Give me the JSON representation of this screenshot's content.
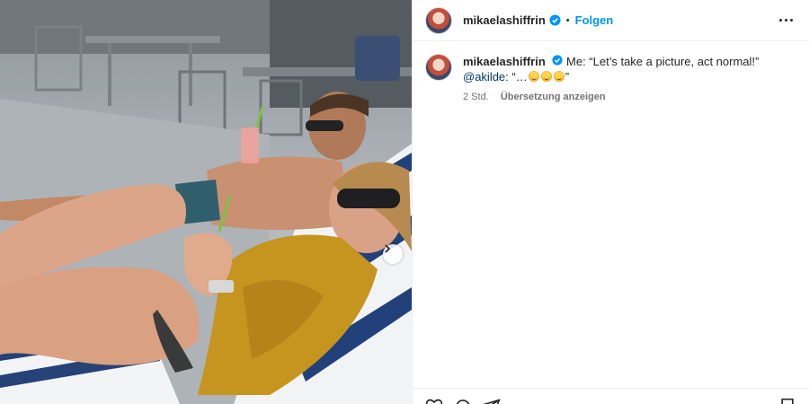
{
  "post": {
    "author": "mikaelashiffrin",
    "follow_label": "Folgen",
    "separator": "•",
    "caption_line1": "Me: “Let’s take a picture, act normal!”",
    "mention": "@akilde",
    "caption_line2_prefix": ": “…",
    "caption_line2_suffix": "”",
    "timestamp": "2 Std.",
    "translate_label": "Übersetzung anzeigen"
  },
  "icons": {
    "verified": "verified-badge-icon",
    "more": "more-options-icon",
    "carousel": "chevron-right-icon",
    "like": "heart-icon",
    "comment": "comment-icon",
    "share": "share-icon",
    "save": "bookmark-icon"
  },
  "colors": {
    "link_blue": "#0095f6",
    "verified_blue": "#0095f6",
    "meta_gray": "#737373",
    "mention": "#00376b"
  }
}
